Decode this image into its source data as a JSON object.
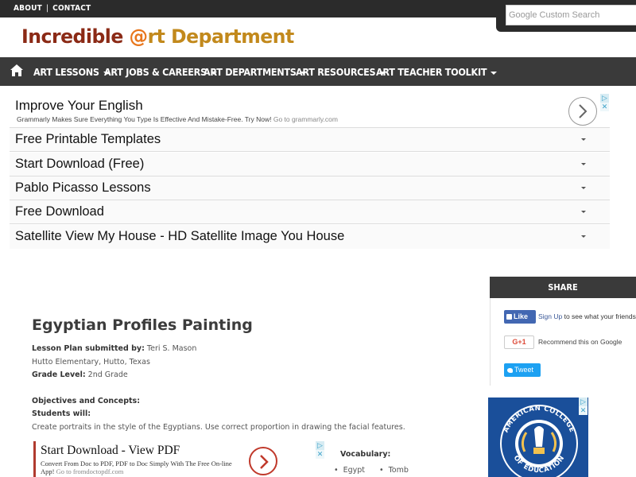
{
  "topbar": {
    "about": "ABOUT",
    "separator": "|",
    "contact": "CONTACT"
  },
  "search": {
    "placeholder": "Google Custom Search"
  },
  "logo": {
    "part1": "Incredible ",
    "part2": "@",
    "part3": "rt Department"
  },
  "nav": {
    "items": [
      "ART LESSONS",
      "ART JOBS & CAREERS",
      "ART DEPARTMENTS",
      "ART RESOURCES",
      "ART TEACHER TOOLKIT"
    ]
  },
  "ad_top": {
    "title": "Improve Your English",
    "subtitle": "Grammarly Makes Sure Everything You Type Is Effective And Mistake-Free. Try Now!",
    "url": "Go to grammarly.com",
    "rows": [
      "Free Printable Templates",
      "Start Download (Free)",
      "Pablo Picasso Lessons",
      "Free Download",
      "Satellite View My House - HD Satellite Image You House"
    ]
  },
  "share": {
    "header": "SHARE",
    "like_label": "Like",
    "like_signup": "Sign Up",
    "like_text": " to see what your friends like.",
    "gplus_label": "G+1",
    "gplus_text": "Recommend this on Google",
    "tweet_label": "Tweet"
  },
  "seal": {
    "text_top": "AMERICAN COLLEGE",
    "text_bottom": "OF EDUCATION"
  },
  "article": {
    "title": "Egyptian Profiles Painting",
    "submitted_label": "Lesson Plan submitted by:",
    "submitted_by": " Teri S. Mason",
    "school": "Hutto Elementary, Hutto, Texas",
    "grade_label": "Grade Level:",
    "grade": " 2nd Grade",
    "objectives": "Objectives and Concepts:",
    "students_will": "Students will:",
    "objective_text": "Create portraits in the style of the Egyptians. Use correct proportion in drawing the facial features."
  },
  "inner_ad": {
    "title": "Start Download - View PDF",
    "text": "Convert From Doc to PDF, PDF to Doc Simply With The Free On-line App!",
    "url": "Go to fromdoctopdf.com"
  },
  "vocab": {
    "title": "Vocabulary:",
    "items": [
      "Egypt",
      "Tomb"
    ]
  },
  "colors": {
    "dark_bar": "#2b2b2b",
    "nav_bg": "#3a3a3a",
    "logo_red": "#8b2a16",
    "logo_orange": "#e8761c",
    "facebook": "#4267b2",
    "twitter": "#1da1f2"
  }
}
